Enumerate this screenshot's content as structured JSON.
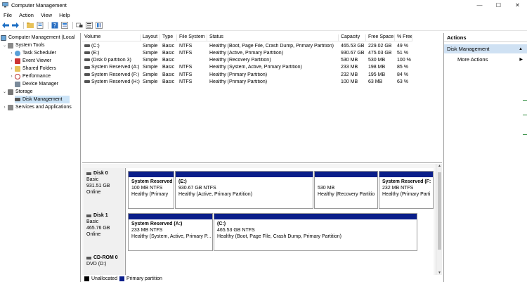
{
  "window": {
    "title": "Computer Management",
    "controls": {
      "minimize": "—",
      "maximize": "☐",
      "close": "✕"
    }
  },
  "menu": [
    "File",
    "Action",
    "View",
    "Help"
  ],
  "toolbar": {
    "icons": [
      "back-arrow-icon",
      "forward-arrow-icon",
      "folder-up-icon",
      "properties-icon",
      "help-icon",
      "view-icon",
      "connect-icon",
      "options-icon",
      "extra-icon"
    ]
  },
  "tree": {
    "root": "Computer Management (Local",
    "system_tools": "System Tools",
    "task_scheduler": "Task Scheduler",
    "event_viewer": "Event Viewer",
    "shared_folders": "Shared Folders",
    "performance": "Performance",
    "device_manager": "Device Manager",
    "storage": "Storage",
    "disk_management": "Disk Management",
    "services": "Services and Applications"
  },
  "columns": [
    "Volume",
    "Layout",
    "Type",
    "File System",
    "Status",
    "Capacity",
    "Free Space",
    "% Free"
  ],
  "volumes": [
    {
      "volume": "(C:)",
      "layout": "Simple",
      "type": "Basic",
      "fs": "NTFS",
      "status": "Healthy (Boot, Page File, Crash Dump, Primary Partition)",
      "capacity": "465.53 GB",
      "free": "229.02 GB",
      "pct": "49 %"
    },
    {
      "volume": "(E:)",
      "layout": "Simple",
      "type": "Basic",
      "fs": "NTFS",
      "status": "Healthy (Active, Primary Partition)",
      "capacity": "930.67 GB",
      "free": "475.03 GB",
      "pct": "51 %"
    },
    {
      "volume": "(Disk 0 partition 3)",
      "layout": "Simple",
      "type": "Basic",
      "fs": "",
      "status": "Healthy (Recovery Partition)",
      "capacity": "530 MB",
      "free": "530 MB",
      "pct": "100 %"
    },
    {
      "volume": "System Reserved (A:)",
      "layout": "Simple",
      "type": "Basic",
      "fs": "NTFS",
      "status": "Healthy (System, Active, Primary Partition)",
      "capacity": "233 MB",
      "free": "198 MB",
      "pct": "85 %"
    },
    {
      "volume": "System Reserved (F:)",
      "layout": "Simple",
      "type": "Basic",
      "fs": "NTFS",
      "status": "Healthy (Primary Partition)",
      "capacity": "232 MB",
      "free": "195 MB",
      "pct": "84 %"
    },
    {
      "volume": "System Reserved (H:)",
      "layout": "Simple",
      "type": "Basic",
      "fs": "NTFS",
      "status": "Healthy (Primary Partition)",
      "capacity": "100 MB",
      "free": "63 MB",
      "pct": "63 %"
    }
  ],
  "disks": [
    {
      "name": "Disk 0",
      "kind": "Basic",
      "size": "931.51 GB",
      "state": "Online",
      "partitions": [
        {
          "name": "System Reserved",
          "size": "100 MB NTFS",
          "status": "Healthy (Primary"
        },
        {
          "name": "(E:)",
          "size": "930.67 GB NTFS",
          "status": "Healthy (Active, Primary Partition)"
        },
        {
          "name": "",
          "size": "530 MB",
          "status": "Healthy (Recovery Partitio"
        },
        {
          "name": "System Reserved  (F:",
          "size": "232 MB NTFS",
          "status": "Healthy (Primary Parti"
        }
      ]
    },
    {
      "name": "Disk 1",
      "kind": "Basic",
      "size": "465.76 GB",
      "state": "Online",
      "partitions": [
        {
          "name": "System Reserved  (A:)",
          "size": "233 MB NTFS",
          "status": "Healthy (System, Active, Primary P..."
        },
        {
          "name": "(C:)",
          "size": "465.53 GB NTFS",
          "status": "Healthy (Boot, Page File, Crash Dump, Primary Partition)"
        }
      ]
    },
    {
      "name": "CD-ROM 0",
      "kind": "DVD (D:)"
    }
  ],
  "legend": {
    "unallocated": "Unallocated",
    "primary": "Primary partition",
    "unallocated_color": "#000000",
    "primary_color": "#0a1e8a"
  },
  "actions": {
    "header": "Actions",
    "section": "Disk Management",
    "more": "More Actions"
  }
}
